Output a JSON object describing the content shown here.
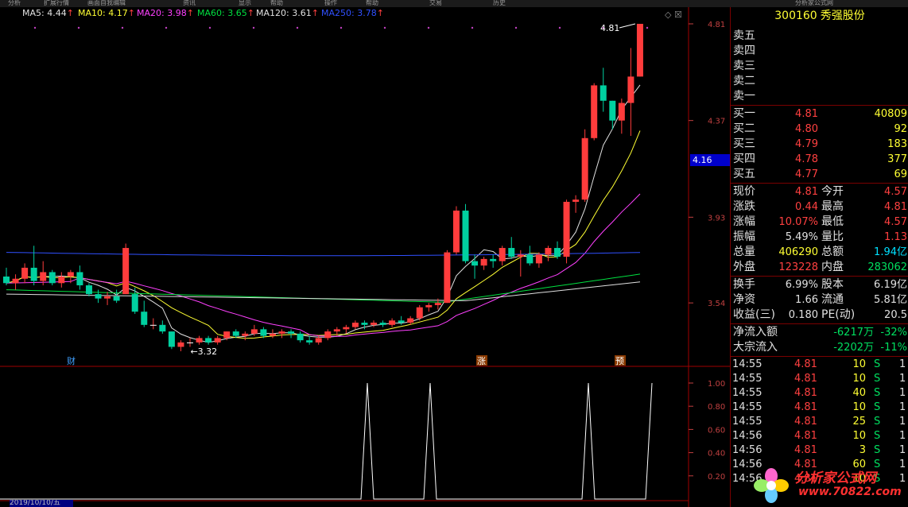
{
  "topbar": {
    "segments": [
      "分析",
      "扩展行情",
      "画面自我编辑",
      "资讯",
      "显示",
      "帮助",
      "操作",
      "帮助",
      "交易",
      "历史",
      "分析家公式网"
    ]
  },
  "ma_legend": [
    {
      "label": "MA5: 4.44",
      "color": "#e0e0e0"
    },
    {
      "label": "MA10: 4.17",
      "color": "#ffff33"
    },
    {
      "label": "MA20: 3.98",
      "color": "#ff40ff"
    },
    {
      "label": "MA60: 3.65",
      "color": "#00e040"
    },
    {
      "label": "MA120: 3.61",
      "color": "#e0e0e0"
    },
    {
      "label": "MA250: 3.78",
      "color": "#3050ff"
    }
  ],
  "chart_data": {
    "type": "candlestick",
    "price_axis_ticks": [
      "4.81",
      "4.37",
      "3.93",
      "3.54"
    ],
    "indicator_axis_ticks": [
      "1.00",
      "0.80",
      "0.60",
      "0.40",
      "0.20"
    ],
    "price_range": [
      3.32,
      4.81
    ],
    "current_price_tag": "4.16",
    "annotations": [
      {
        "text": "4.81",
        "type": "high-marker"
      },
      {
        "text": "3.32",
        "type": "low-marker"
      }
    ],
    "event_markers": [
      "财",
      "涨",
      "预"
    ],
    "candles": [
      [
        3.66,
        3.7,
        3.62,
        3.63
      ],
      [
        3.63,
        3.67,
        3.6,
        3.65
      ],
      [
        3.65,
        3.72,
        3.63,
        3.7
      ],
      [
        3.7,
        3.8,
        3.62,
        3.64
      ],
      [
        3.64,
        3.73,
        3.62,
        3.68
      ],
      [
        3.68,
        3.69,
        3.62,
        3.63
      ],
      [
        3.63,
        3.68,
        3.61,
        3.66
      ],
      [
        3.66,
        3.69,
        3.63,
        3.68
      ],
      [
        3.68,
        3.71,
        3.6,
        3.62
      ],
      [
        3.62,
        3.63,
        3.57,
        3.58
      ],
      [
        3.58,
        3.6,
        3.54,
        3.56
      ],
      [
        3.56,
        3.59,
        3.53,
        3.57
      ],
      [
        3.57,
        3.6,
        3.54,
        3.55
      ],
      [
        3.58,
        3.81,
        3.58,
        3.79
      ],
      [
        3.58,
        3.61,
        3.49,
        3.5
      ],
      [
        3.5,
        3.55,
        3.43,
        3.44
      ],
      [
        3.44,
        3.47,
        3.42,
        3.44
      ],
      [
        3.44,
        3.46,
        3.4,
        3.41
      ],
      [
        3.41,
        3.41,
        3.33,
        3.34
      ],
      [
        3.34,
        3.37,
        3.32,
        3.36
      ],
      [
        3.36,
        3.38,
        3.34,
        3.36
      ],
      [
        3.36,
        3.39,
        3.35,
        3.38
      ],
      [
        3.38,
        3.39,
        3.35,
        3.36
      ],
      [
        3.36,
        3.39,
        3.35,
        3.38
      ],
      [
        3.38,
        3.41,
        3.37,
        3.41
      ],
      [
        3.41,
        3.42,
        3.38,
        3.39
      ],
      [
        3.39,
        3.41,
        3.37,
        3.4
      ],
      [
        3.4,
        3.44,
        3.39,
        3.42
      ],
      [
        3.42,
        3.43,
        3.38,
        3.39
      ],
      [
        3.39,
        3.42,
        3.38,
        3.4
      ],
      [
        3.4,
        3.42,
        3.38,
        3.41
      ],
      [
        3.41,
        3.42,
        3.38,
        3.4
      ],
      [
        3.4,
        3.41,
        3.36,
        3.37
      ],
      [
        3.37,
        3.39,
        3.35,
        3.36
      ],
      [
        3.36,
        3.39,
        3.35,
        3.38
      ],
      [
        3.38,
        3.42,
        3.37,
        3.41
      ],
      [
        3.41,
        3.43,
        3.39,
        3.42
      ],
      [
        3.42,
        3.44,
        3.4,
        3.43
      ],
      [
        3.43,
        3.46,
        3.42,
        3.45
      ],
      [
        3.45,
        3.46,
        3.42,
        3.44
      ],
      [
        3.44,
        3.46,
        3.43,
        3.45
      ],
      [
        3.45,
        3.46,
        3.43,
        3.44
      ],
      [
        3.44,
        3.47,
        3.43,
        3.46
      ],
      [
        3.46,
        3.48,
        3.44,
        3.45
      ],
      [
        3.45,
        3.48,
        3.44,
        3.47
      ],
      [
        3.47,
        3.53,
        3.46,
        3.52
      ],
      [
        3.52,
        3.54,
        3.5,
        3.53
      ],
      [
        3.53,
        3.56,
        3.51,
        3.54
      ],
      [
        3.54,
        3.78,
        3.54,
        3.77
      ],
      [
        3.77,
        3.98,
        3.76,
        3.96
      ],
      [
        3.96,
        3.99,
        3.72,
        3.73
      ],
      [
        3.73,
        3.76,
        3.65,
        3.71
      ],
      [
        3.71,
        3.75,
        3.69,
        3.74
      ],
      [
        3.74,
        3.76,
        3.7,
        3.73
      ],
      [
        3.73,
        3.8,
        3.71,
        3.79
      ],
      [
        3.79,
        3.84,
        3.74,
        3.75
      ],
      [
        3.75,
        3.78,
        3.66,
        3.76
      ],
      [
        3.76,
        3.8,
        3.71,
        3.72
      ],
      [
        3.72,
        3.77,
        3.7,
        3.76
      ],
      [
        3.76,
        3.8,
        3.73,
        3.79
      ],
      [
        3.79,
        3.82,
        3.74,
        3.75
      ],
      [
        3.75,
        4.01,
        3.72,
        4.0
      ],
      [
        4.0,
        4.03,
        3.95,
        4.01
      ],
      [
        4.01,
        4.33,
        4.0,
        4.29
      ],
      [
        4.29,
        4.54,
        4.28,
        4.53
      ],
      [
        4.53,
        4.61,
        4.41,
        4.46
      ],
      [
        4.46,
        4.46,
        4.33,
        4.37
      ],
      [
        4.37,
        4.47,
        4.31,
        4.45
      ],
      [
        4.45,
        4.7,
        4.3,
        4.57
      ],
      [
        4.57,
        4.81,
        4.57,
        4.81
      ]
    ],
    "indicator_peaks_at_candle": [
      31,
      36,
      61,
      67
    ]
  },
  "right_panel": {
    "code": "300160",
    "name": "秀强股份",
    "sell_levels": [
      "卖五",
      "卖四",
      "卖三",
      "卖二",
      "卖一"
    ],
    "buy_levels": [
      {
        "label": "买一",
        "price": "4.81",
        "vol": "40809"
      },
      {
        "label": "买二",
        "price": "4.80",
        "vol": "92"
      },
      {
        "label": "买三",
        "price": "4.79",
        "vol": "183"
      },
      {
        "label": "买四",
        "price": "4.78",
        "vol": "377"
      },
      {
        "label": "买五",
        "price": "4.77",
        "vol": "69"
      }
    ],
    "stats": [
      {
        "l1": "现价",
        "v1": "4.81",
        "c1": "red",
        "l2": "今开",
        "v2": "4.57",
        "c2": "red"
      },
      {
        "l1": "涨跌",
        "v1": "0.44",
        "c1": "red",
        "l2": "最高",
        "v2": "4.81",
        "c2": "red"
      },
      {
        "l1": "涨幅",
        "v1": "10.07%",
        "c1": "red",
        "l2": "最低",
        "v2": "4.57",
        "c2": "red"
      },
      {
        "l1": "振幅",
        "v1": "5.49%",
        "c1": "white",
        "l2": "量比",
        "v2": "1.13",
        "c2": "red"
      },
      {
        "l1": "总量",
        "v1": "406290",
        "c1": "yellow",
        "l2": "总额",
        "v2": "1.94亿",
        "c2": "cyan"
      },
      {
        "l1": "外盘",
        "v1": "123228",
        "c1": "red",
        "l2": "内盘",
        "v2": "283062",
        "c2": "green"
      }
    ],
    "fundamentals": [
      {
        "l1": "换手",
        "v1": "6.99%",
        "l2": "股本",
        "v2": "6.19亿"
      },
      {
        "l1": "净资",
        "v1": "1.66",
        "l2": "流通",
        "v2": "5.81亿"
      },
      {
        "l1": "收益(三)",
        "v1": "0.180",
        "l2": "PE(动)",
        "v2": "20.5"
      }
    ],
    "flows": [
      {
        "label": "净流入额",
        "value": "-6217万",
        "pct": "-32%"
      },
      {
        "label": "大宗流入",
        "value": "-2202万",
        "pct": "-11%"
      }
    ],
    "trades": [
      {
        "time": "14:55",
        "price": "4.81",
        "qty": "10",
        "side": "S",
        "n": "1"
      },
      {
        "time": "14:55",
        "price": "4.81",
        "qty": "10",
        "side": "S",
        "n": "1"
      },
      {
        "time": "14:55",
        "price": "4.81",
        "qty": "40",
        "side": "S",
        "n": "1"
      },
      {
        "time": "14:55",
        "price": "4.81",
        "qty": "10",
        "side": "S",
        "n": "1"
      },
      {
        "time": "14:55",
        "price": "4.81",
        "qty": "25",
        "side": "S",
        "n": "1"
      },
      {
        "time": "14:56",
        "price": "4.81",
        "qty": "10",
        "side": "S",
        "n": "1"
      },
      {
        "time": "14:56",
        "price": "4.81",
        "qty": "3",
        "side": "S",
        "n": "1"
      },
      {
        "time": "14:56",
        "price": "4.81",
        "qty": "60",
        "side": "S",
        "n": "1"
      },
      {
        "time": "14:56",
        "price": "4.81",
        "qty": "10",
        "side": "S",
        "n": "1"
      }
    ]
  },
  "watermark": {
    "text": "分析家公式网",
    "url": "www.70822.com"
  },
  "bottom_date": "2019/10/10/五",
  "colors": {
    "up": "#ff3c3c",
    "down": "#00d0a0",
    "grid_border": "#a00000"
  }
}
